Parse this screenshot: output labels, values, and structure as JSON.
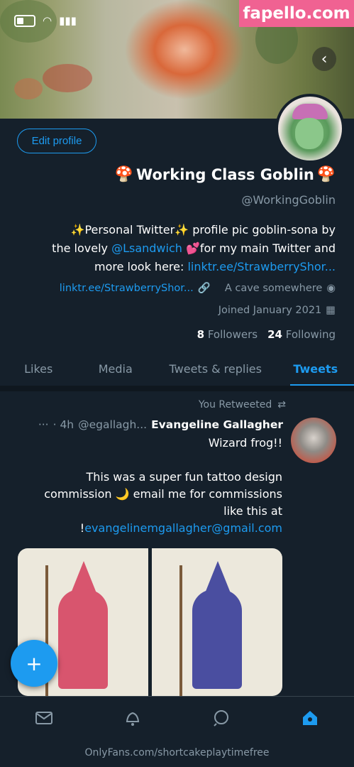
{
  "watermark": "fapello.com",
  "banner": {
    "nav_icon": "chevron-left-icon"
  },
  "profile": {
    "edit_label": "Edit profile",
    "name_emoji_left": "🍄",
    "name": "Working Class Goblin",
    "name_emoji_right": "🍄",
    "handle": "@WorkingGoblin",
    "bio_line1": "✨Personal Twitter✨ profile pic goblin-sona by",
    "bio_line2_pre": "the lovely ",
    "bio_mention": "@Lsandwich",
    "bio_line2_post": " 💕for my main Twitter and",
    "bio_line3_pre": "more look here: ",
    "bio_link": "linktr.ee/StrawberryShor...",
    "location": "A cave somewhere",
    "website": "linktr.ee/StrawberryShor...",
    "joined": "Joined January 2021",
    "following_count": "24",
    "following_label": "Following",
    "followers_count": "8",
    "followers_label": "Followers"
  },
  "tabs": [
    {
      "label": "Tweets"
    },
    {
      "label": "Tweets & replies"
    },
    {
      "label": "Media"
    },
    {
      "label": "Likes"
    }
  ],
  "tweet": {
    "retweet_label": "You Retweeted",
    "author": "Evangeline Gallagher",
    "handle": "@egallagh...",
    "time": "· 4h",
    "more": "···",
    "line1": "Wizard frog!!",
    "line2": "This was a super fun tattoo design",
    "line3": "commission 🌙 email me for commissions",
    "line4": "like this at",
    "email": "evangelinemgallagher@gmail.com",
    "email_suffix": "!"
  },
  "fab": {
    "label": "+"
  },
  "bottom_nav": [
    "home-icon",
    "search-icon",
    "notifications-icon",
    "messages-icon"
  ],
  "footer_url": "OnlyFans.com/shortcakeplaytimefree",
  "colors": {
    "accent": "#1d9bf0",
    "background": "#15202b",
    "secondary_text": "#8899a6"
  }
}
